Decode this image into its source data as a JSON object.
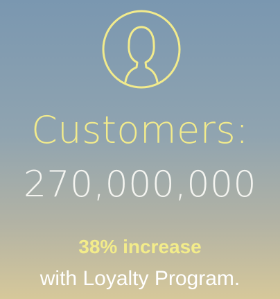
{
  "icon": "user-profile-icon",
  "colors": {
    "accent": "#f2eb8c",
    "number": "#f4f4f0",
    "background_top": "#7a97b0",
    "background_bottom": "#d6c89a"
  },
  "stat": {
    "label": "Customers:",
    "value": "270,000,000",
    "increase": "38% increase",
    "note": "with Loyalty Program."
  }
}
